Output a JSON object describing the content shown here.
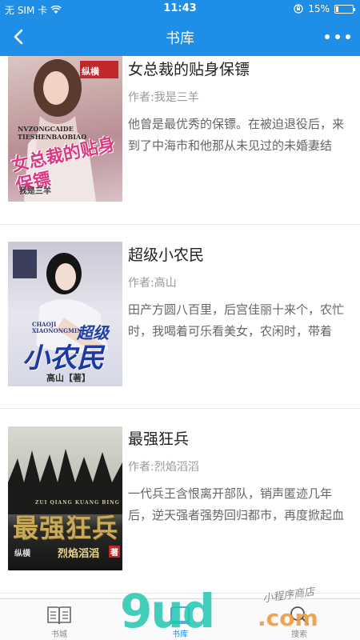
{
  "status_bar": {
    "carrier": "无 SIM 卡",
    "time": "11:43",
    "battery_text": "15%",
    "battery_level": 0.15
  },
  "nav": {
    "title": "书库"
  },
  "books": [
    {
      "title": "女总裁的贴身保镖",
      "author": "作者:我是三羊",
      "description": "他曾是最优秀的保镖。在被迫退役后，来到了中海市和他那从未见过的未婚妻结",
      "cover_title": "女总裁的贴身保镖",
      "cover_pinyin": "NVZONGCAIDE TIESHENBAOBIAO",
      "cover_author": "我是三羊",
      "cover_publisher": "纵横"
    },
    {
      "title": "超级小农民",
      "author": "作者:高山",
      "description": "田产方圆八百里，后宫佳丽十来个，农忙时，我喝着可乐看美女，农闲时，带着",
      "cover_title_top": "超级",
      "cover_title_main": "小农民",
      "cover_pinyin": "CHAOJI XIAONONGMIN",
      "cover_author": "高山【著】"
    },
    {
      "title": "最强狂兵",
      "author": "作者:烈焰滔滔",
      "description": "一代兵王含恨离开部队，销声匿迹几年后，逆天强者强势回归都市，再度掀起血",
      "cover_title": "最强狂兵",
      "cover_pinyin": "ZUI QIANG KUANG BING",
      "cover_author": "烈焰滔滔",
      "cover_author_suffix": "著",
      "cover_publisher": "纵横"
    }
  ],
  "tabs": [
    {
      "label": "书城",
      "icon": "book-open-icon",
      "active": false
    },
    {
      "label": "书库",
      "icon": "bookshelf-icon",
      "active": true
    },
    {
      "label": "搜索",
      "icon": "search-icon",
      "active": false
    }
  ],
  "watermark": {
    "main": "9ud",
    "suffix": ".com",
    "tagline": "小程序商店"
  },
  "colors": {
    "primary": "#1e8ee6",
    "watermark_green": "#22c7b0",
    "watermark_orange": "#f09a3e"
  }
}
